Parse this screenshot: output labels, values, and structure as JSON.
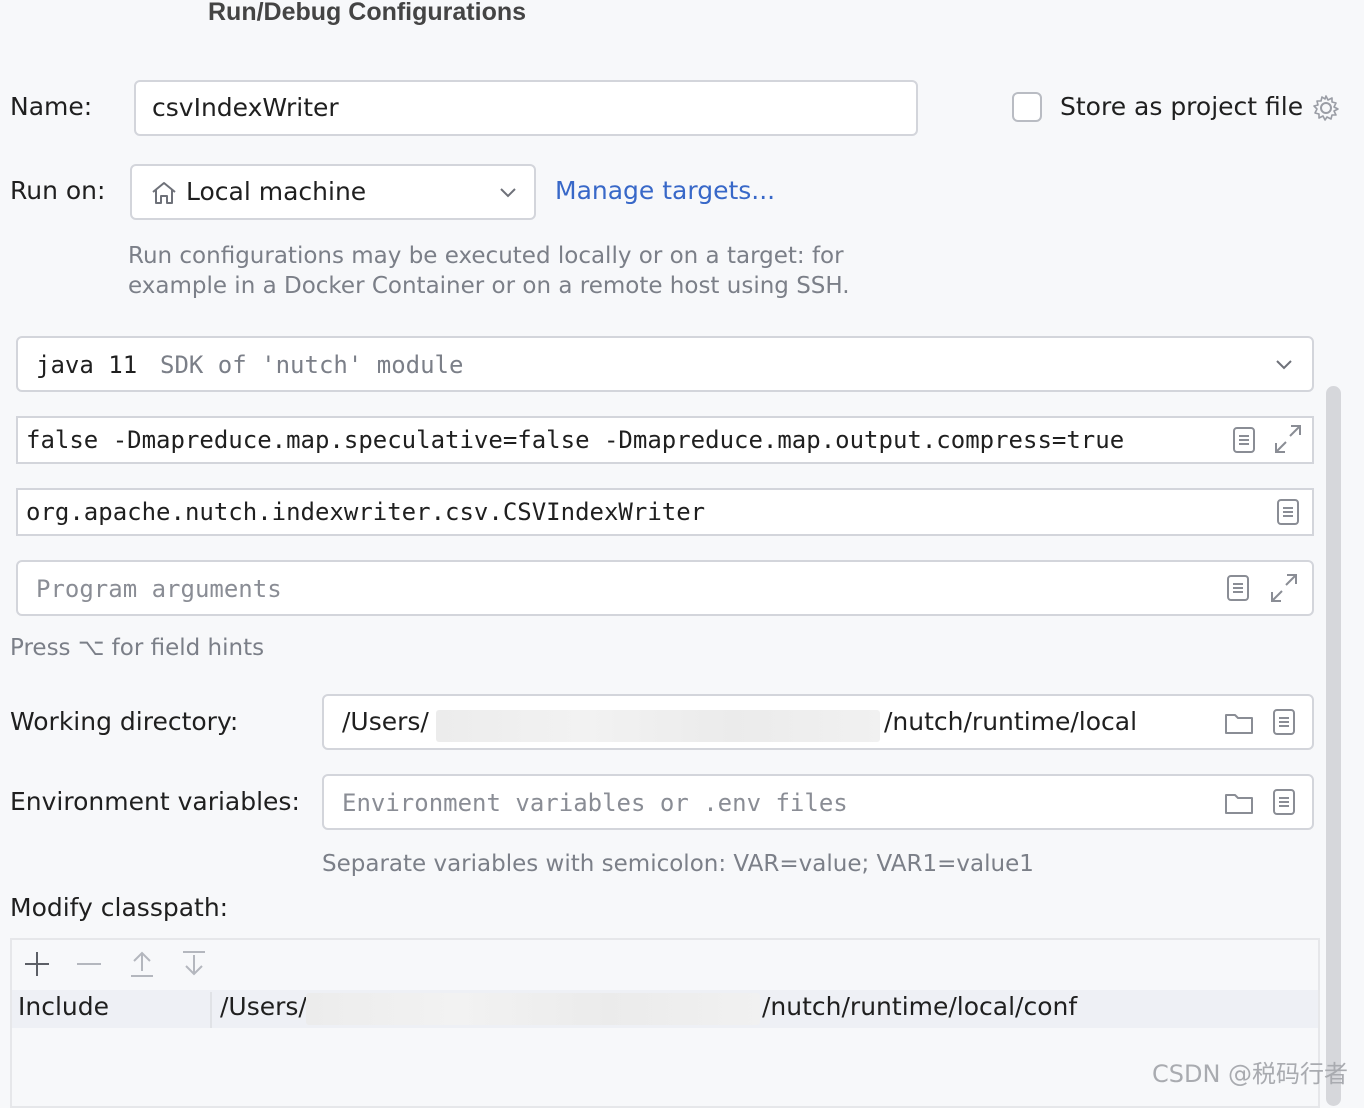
{
  "dialog": {
    "title": "Run/Debug Configurations"
  },
  "name": {
    "label": "Name:",
    "value": "csvIndexWriter"
  },
  "store_project": {
    "label": "Store as project file",
    "checked": false
  },
  "run_on": {
    "label": "Run on:",
    "value": "Local machine",
    "manage_link": "Manage targets...",
    "hint_line1": "Run configurations may be executed locally or on a target: for",
    "hint_line2": "example in a Docker Container or on a remote host using SSH."
  },
  "jdk": {
    "version": "java 11",
    "detail": "SDK of 'nutch' module"
  },
  "vm_options": {
    "value": "false -Dmapreduce.map.speculative=false -Dmapreduce.map.output.compress=true"
  },
  "main_class": {
    "value": "org.apache.nutch.indexwriter.csv.CSVIndexWriter"
  },
  "program_args": {
    "placeholder": "Program arguments"
  },
  "field_hints": "Press ⌥ for field hints",
  "working_dir": {
    "label": "Working directory:",
    "prefix": "/Users/",
    "suffix": "/nutch/runtime/local"
  },
  "env_vars": {
    "label": "Environment variables:",
    "placeholder": "Environment variables or .env files",
    "hint": "Separate variables with semicolon: VAR=value; VAR1=value1"
  },
  "classpath": {
    "label": "Modify classpath:",
    "rows": [
      {
        "type": "Include",
        "prefix": "/Users/",
        "suffix": "/nutch/runtime/local/conf"
      }
    ]
  },
  "watermark": "CSDN @税码行者",
  "colors": {
    "link": "#3868c8",
    "border": "#d3d5db",
    "background": "#f7f8fa"
  }
}
